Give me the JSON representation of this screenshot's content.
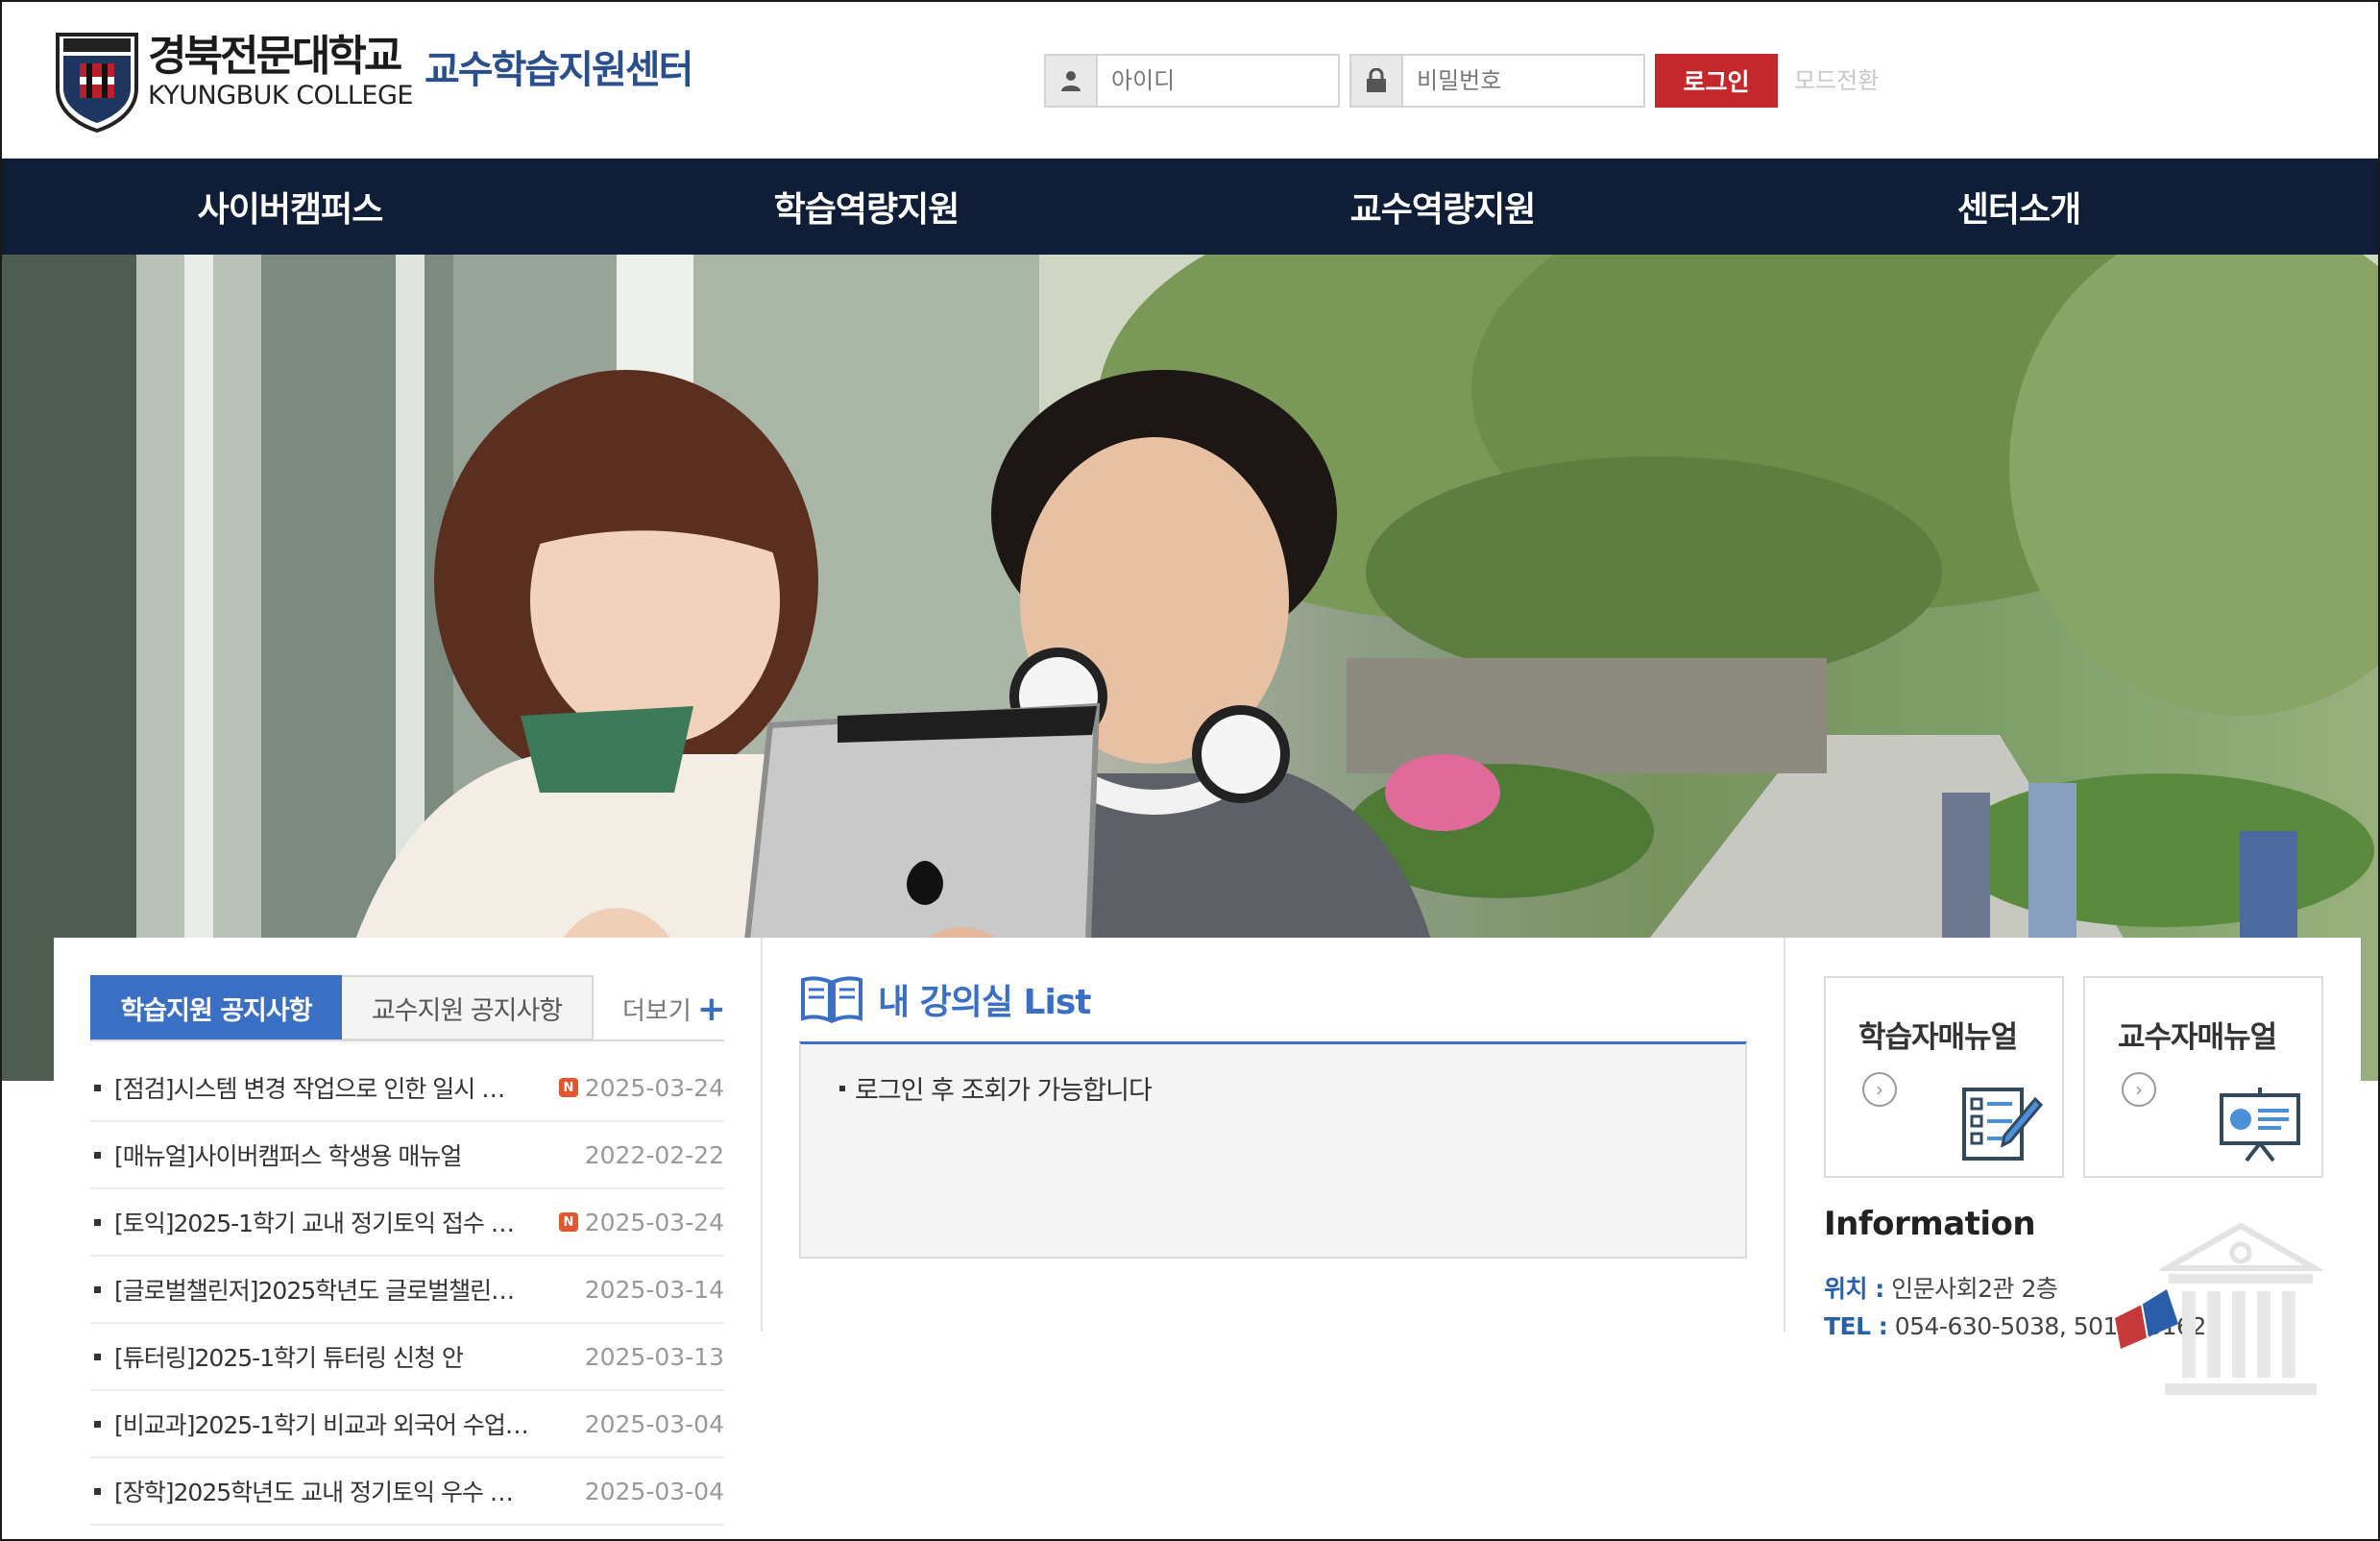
{
  "header": {
    "logo_kr": "경북전문대학교",
    "logo_en": "KYUNGBUK COLLEGE",
    "center_title": "교수학습지원센터",
    "login": {
      "id_placeholder": "아이디",
      "pw_placeholder": "비밀번호",
      "button_label": "로그인"
    },
    "mode_link": "모드전환"
  },
  "nav": {
    "items": [
      {
        "label": "사이버캠퍼스"
      },
      {
        "label": "학습역량지원"
      },
      {
        "label": "교수역량지원"
      },
      {
        "label": "센터소개"
      }
    ]
  },
  "notices": {
    "tabs": [
      {
        "label": "학습지원 공지사항"
      },
      {
        "label": "교수지원 공지사항"
      }
    ],
    "more_label": "더보기",
    "items": [
      {
        "title": "[점검]시스템 변경 작업으로 인한 일시 …",
        "date": "2025-03-24",
        "is_new": true
      },
      {
        "title": "[매뉴얼]사이버캠퍼스 학생용 매뉴얼",
        "date": "2022-02-22",
        "is_new": false
      },
      {
        "title": "[토익]2025-1학기 교내 정기토익 접수 …",
        "date": "2025-03-24",
        "is_new": true
      },
      {
        "title": "[글로벌챌린저]2025학년도 글로벌챌린…",
        "date": "2025-03-14",
        "is_new": false
      },
      {
        "title": "[튜터링]2025-1학기 튜터링 신청 안",
        "date": "2025-03-13",
        "is_new": false
      },
      {
        "title": "[비교과]2025-1학기 비교과 외국어 수업…",
        "date": "2025-03-04",
        "is_new": false
      },
      {
        "title": "[장학]2025학년도 교내 정기토익 우수 …",
        "date": "2025-03-04",
        "is_new": false
      }
    ],
    "new_badge": "N"
  },
  "lecture": {
    "title": "내 강의실 List",
    "message": "로그인 후 조회가 가능합니다"
  },
  "manuals": {
    "learner": "학습자매뉴얼",
    "professor": "교수자매뉴얼"
  },
  "info": {
    "title": "Information",
    "location_key": "위치 :",
    "location_value": "인문사회2관 2층",
    "tel_key": "TEL :",
    "tel_value": "054-630-5038, 5017, 5162"
  },
  "colors": {
    "nav_bg": "#0f1d36",
    "accent_blue": "#3a6fc4",
    "login_red": "#c4282c",
    "title_blue": "#2b4f8c"
  }
}
